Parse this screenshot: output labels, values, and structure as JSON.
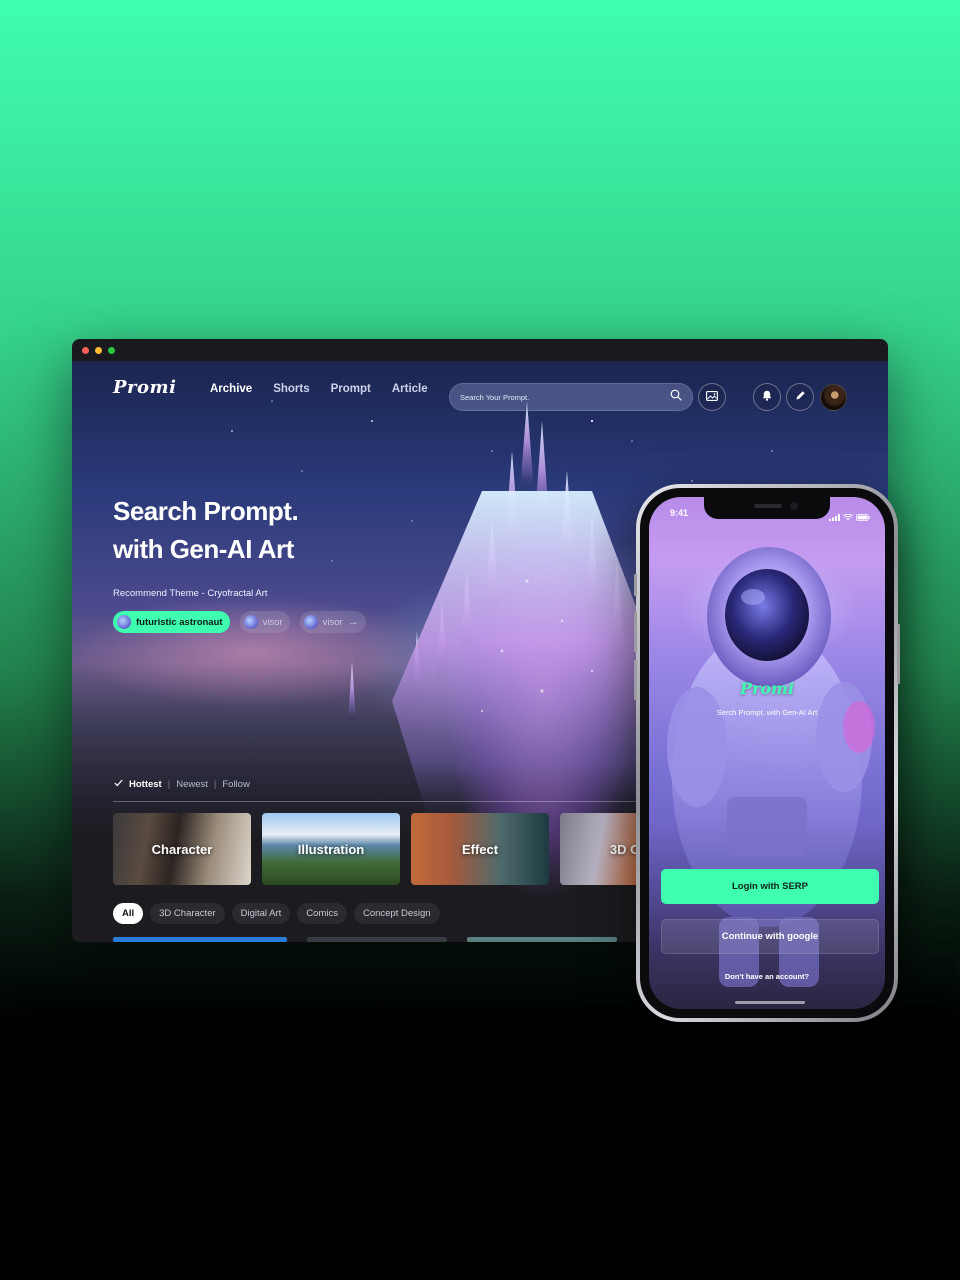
{
  "window": {
    "dot_colors": [
      "#fe5f57",
      "#febc2e",
      "#28c840"
    ]
  },
  "nav": {
    "logo": "Promi",
    "links": [
      {
        "label": "Archive",
        "active": true
      },
      {
        "label": "Shorts",
        "active": false
      },
      {
        "label": "Prompt",
        "active": false
      },
      {
        "label": "Article",
        "active": false
      }
    ]
  },
  "search": {
    "placeholder": "Search Your Prompt.",
    "icon": "search-icon"
  },
  "toolbar": {
    "icons": [
      "image-icon",
      "bell-icon",
      "pen-icon",
      "avatar"
    ]
  },
  "hero": {
    "title_line1": "Search Prompt.",
    "title_line2": "with Gen-AI Art",
    "recommend": "Recommend Theme - Cryofractal Art",
    "chips": [
      {
        "label": "futuristic astronaut",
        "active": true
      },
      {
        "label": "visor",
        "active": false
      },
      {
        "label": "visor",
        "active": false
      }
    ]
  },
  "filters": {
    "items": [
      {
        "label": "Hottest",
        "active": true
      },
      {
        "label": "Newest",
        "active": false
      },
      {
        "label": "Follow",
        "active": false
      }
    ]
  },
  "categories": [
    {
      "label": "Character"
    },
    {
      "label": "Illustration"
    },
    {
      "label": "Effect"
    },
    {
      "label": "3D Ob"
    }
  ],
  "tags": [
    {
      "label": "All",
      "active": true
    },
    {
      "label": "3D Character",
      "active": false
    },
    {
      "label": "Digital Art",
      "active": false
    },
    {
      "label": "Comics",
      "active": false
    },
    {
      "label": "Concept Design",
      "active": false
    }
  ],
  "colors": {
    "accent": "#3ffeb0",
    "background_top": "#3ffeb0",
    "background_bottom": "#000000"
  },
  "phone": {
    "time": "9:41",
    "logo": "Promi",
    "subtitle": "Serch Prompt. with Gen-AI Art",
    "login_button": "Login with SERP",
    "google_button": "Continue with google",
    "no_account": "Don't have an account?"
  }
}
